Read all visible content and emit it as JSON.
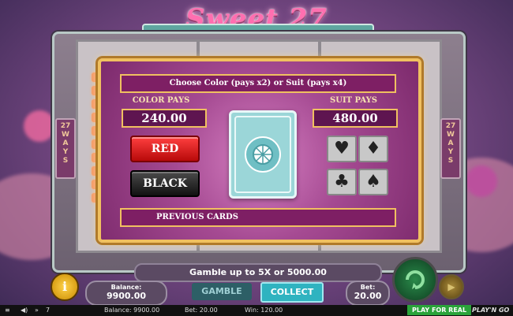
{
  "game": {
    "logo": "Sweet 27",
    "ways_label": [
      "27",
      "W",
      "A",
      "Y",
      "S"
    ]
  },
  "gamble": {
    "header": "Choose Color (pays x2) or Suit (pays x4)",
    "color_pays_label": "COLOR PAYS",
    "color_pays_value": "240.00",
    "suit_pays_label": "SUIT PAYS",
    "suit_pays_value": "480.00",
    "red_label": "RED",
    "black_label": "BLACK",
    "previous_cards_label": "PREVIOUS CARDS",
    "suits": [
      "♥",
      "♦",
      "♣",
      "♠"
    ]
  },
  "footer": {
    "gamble_info": "Gamble up to 5X or 5000.00",
    "balance_label": "Balance:",
    "balance_value": "9900.00",
    "bet_label": "Bet:",
    "bet_value": "20.00",
    "gamble_button": "GAMBLE",
    "collect_button": "COLLECT"
  },
  "statusbar": {
    "counter": "7",
    "balance": "Balance: 9900.00",
    "bet": "Bet: 20.00",
    "win": "Win: 120.00",
    "play_for_real": "PLAY FOR REAL",
    "brand": "PLAY'N GO"
  },
  "colors": {
    "panel_border": "#f0c060",
    "red_button": "#e01818",
    "collect_button": "#2fb3c0"
  }
}
